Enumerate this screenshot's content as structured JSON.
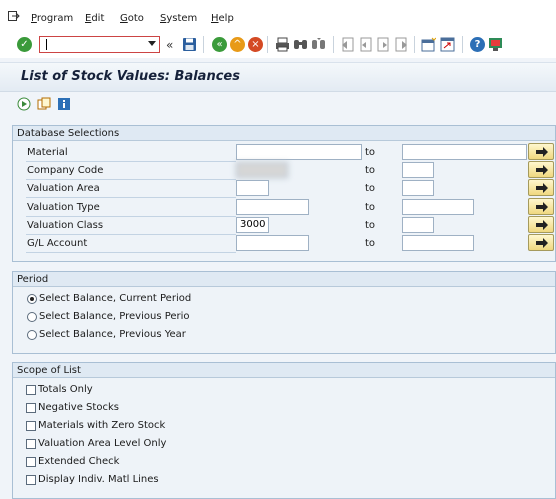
{
  "menubar": {
    "items": [
      "Program",
      "Edit",
      "Goto",
      "System",
      "Help"
    ],
    "underline": [
      "P",
      "E",
      "G",
      "S",
      "H"
    ]
  },
  "toolbar": {
    "command_value": ""
  },
  "title": "List of Stock Values: Balances",
  "database_selections": {
    "title": "Database Selections",
    "to_label": "to",
    "rows": [
      {
        "label": "Material",
        "from": "",
        "to": ""
      },
      {
        "label": "Company Code",
        "from": "",
        "to": ""
      },
      {
        "label": "Valuation Area",
        "from": "",
        "to": ""
      },
      {
        "label": "Valuation Type",
        "from": "",
        "to": ""
      },
      {
        "label": "Valuation Class",
        "from": "3000",
        "to": ""
      },
      {
        "label": "G/L Account",
        "from": "",
        "to": ""
      }
    ]
  },
  "period": {
    "title": "Period",
    "options": [
      {
        "label": "Select Balance, Current Period",
        "selected": true
      },
      {
        "label": "Select Balance, Previous Perio",
        "selected": false
      },
      {
        "label": "Select Balance, Previous Year",
        "selected": false
      }
    ]
  },
  "scope": {
    "title": "Scope of List",
    "options": [
      {
        "label": "Totals Only",
        "checked": false
      },
      {
        "label": "Negative Stocks",
        "checked": false
      },
      {
        "label": "Materials with Zero Stock",
        "checked": false
      },
      {
        "label": "Valuation Area Level Only",
        "checked": false
      },
      {
        "label": "Extended Check",
        "checked": false
      },
      {
        "label": "Display Indiv. Matl Lines",
        "checked": false
      }
    ]
  },
  "colors": {
    "accent_red": "#cc4444",
    "multi_btn": "#f0d880",
    "group_border": "#a9bfd4"
  }
}
